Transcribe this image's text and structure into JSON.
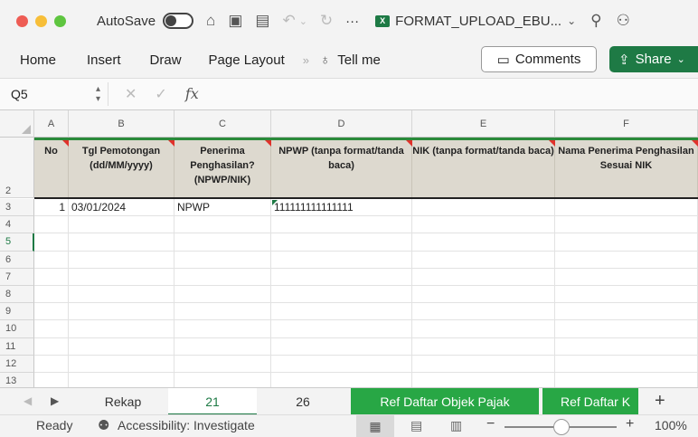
{
  "titlebar": {
    "autosave_label": "AutoSave",
    "file_name": "FORMAT_UPLOAD_EBU...",
    "more": "···"
  },
  "ribbon": {
    "tabs": [
      "Home",
      "Insert",
      "Draw",
      "Page Layout"
    ],
    "more": "»",
    "tell_me": "Tell me",
    "comments": "Comments",
    "share": "Share"
  },
  "formula_bar": {
    "name_box": "Q5",
    "fx": "fx",
    "value": ""
  },
  "columns": [
    "A",
    "B",
    "C",
    "D",
    "E",
    "F"
  ],
  "header_row": {
    "row_number": "2",
    "cells": [
      "No",
      "Tgl Pemotongan (dd/MM/yyyy)",
      "Penerima Penghasilan? (NPWP/NIK)",
      "NPWP (tanpa format/tanda baca)",
      "NIK (tanpa format/tanda baca)",
      "Nama Penerima Penghasilan Sesuai NIK"
    ]
  },
  "rows": [
    {
      "num": "3",
      "cells": [
        "1",
        "03/01/2024",
        "NPWP",
        "111111111111111",
        "",
        ""
      ]
    },
    {
      "num": "4",
      "cells": [
        "",
        "",
        "",
        "",
        "",
        ""
      ]
    },
    {
      "num": "5",
      "cells": [
        "",
        "",
        "",
        "",
        "",
        ""
      ]
    },
    {
      "num": "6",
      "cells": [
        "",
        "",
        "",
        "",
        "",
        ""
      ]
    },
    {
      "num": "7",
      "cells": [
        "",
        "",
        "",
        "",
        "",
        ""
      ]
    },
    {
      "num": "8",
      "cells": [
        "",
        "",
        "",
        "",
        "",
        ""
      ]
    },
    {
      "num": "9",
      "cells": [
        "",
        "",
        "",
        "",
        "",
        ""
      ]
    },
    {
      "num": "10",
      "cells": [
        "",
        "",
        "",
        "",
        "",
        ""
      ]
    },
    {
      "num": "11",
      "cells": [
        "",
        "",
        "",
        "",
        "",
        ""
      ]
    },
    {
      "num": "12",
      "cells": [
        "",
        "",
        "",
        "",
        "",
        ""
      ]
    },
    {
      "num": "13",
      "cells": [
        "",
        "",
        "",
        "",
        "",
        ""
      ]
    }
  ],
  "selected_row": "5",
  "sheets": [
    {
      "label": "Rekap",
      "style": "normal"
    },
    {
      "label": "21",
      "style": "active"
    },
    {
      "label": "26",
      "style": "normal"
    },
    {
      "label": "Ref Daftar Objek Pajak",
      "style": "green"
    },
    {
      "label": "Ref Daftar K",
      "style": "green"
    }
  ],
  "add_sheet": "+",
  "status": {
    "ready": "Ready",
    "accessibility": "Accessibility: Investigate",
    "zoom_minus": "−",
    "zoom_plus": "+",
    "zoom": "100%",
    "zoom_level": 1.0
  },
  "colors": {
    "brand_green": "#1e7a45",
    "header_fill": "#ddd9cf",
    "comment_red": "#e0312b"
  }
}
